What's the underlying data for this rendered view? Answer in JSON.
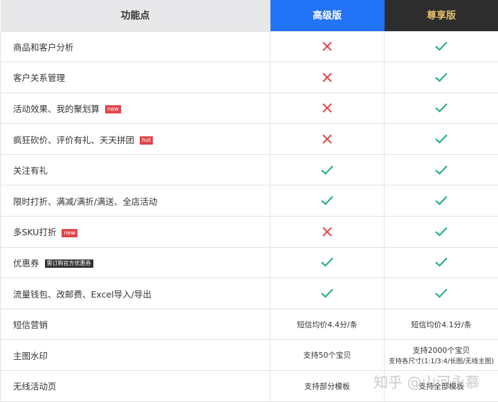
{
  "header": {
    "feature": "功能点",
    "advanced": "高级版",
    "premium": "尊享版"
  },
  "colors": {
    "advanced": "#2273f5",
    "premium_bg": "#2d2d2d",
    "premium_text": "#e3be6a",
    "check": "#27b07c",
    "cross": "#e0464b",
    "badge_red": "#e0464b",
    "badge_dark": "#333333"
  },
  "rows": [
    {
      "feature": "商品和客户分析",
      "advanced": "cross",
      "premium": "check"
    },
    {
      "feature": "客户关系管理",
      "advanced": "cross",
      "premium": "check"
    },
    {
      "feature": "活动效果、我的聚划算",
      "badge": "new",
      "advanced": "cross",
      "premium": "check"
    },
    {
      "feature": "疯狂砍价、评价有礼、天天拼团",
      "badge": "hot",
      "advanced": "cross",
      "premium": "check"
    },
    {
      "feature": "关注有礼",
      "advanced": "check",
      "premium": "check"
    },
    {
      "feature": "限时打折、满减/满折/满送、全店活动",
      "advanced": "check",
      "premium": "check"
    },
    {
      "feature": "多SKU打折",
      "badge": "new",
      "advanced": "cross",
      "premium": "check"
    },
    {
      "feature": "优惠券",
      "badge_dark": "需订购官方优惠券",
      "advanced": "check",
      "premium": "check"
    },
    {
      "feature": "流量钱包、改邮费、Excel导入/导出",
      "advanced": "check",
      "premium": "check"
    },
    {
      "feature": "短信营销",
      "advanced_text": "短信均价4.4分/条",
      "premium_text": "短信均价4.1分/条"
    },
    {
      "feature": "主图水印",
      "advanced_text": "支持50个宝贝",
      "premium_text": "支持2000个宝贝",
      "premium_sub": "支持各尺寸(1:1/3:4/长图/无线主图)"
    },
    {
      "feature": "无线活动页",
      "advanced_text": "支持部分模板",
      "premium_text": "支持全部模板"
    }
  ],
  "watermark": "知乎 @山河永慕"
}
